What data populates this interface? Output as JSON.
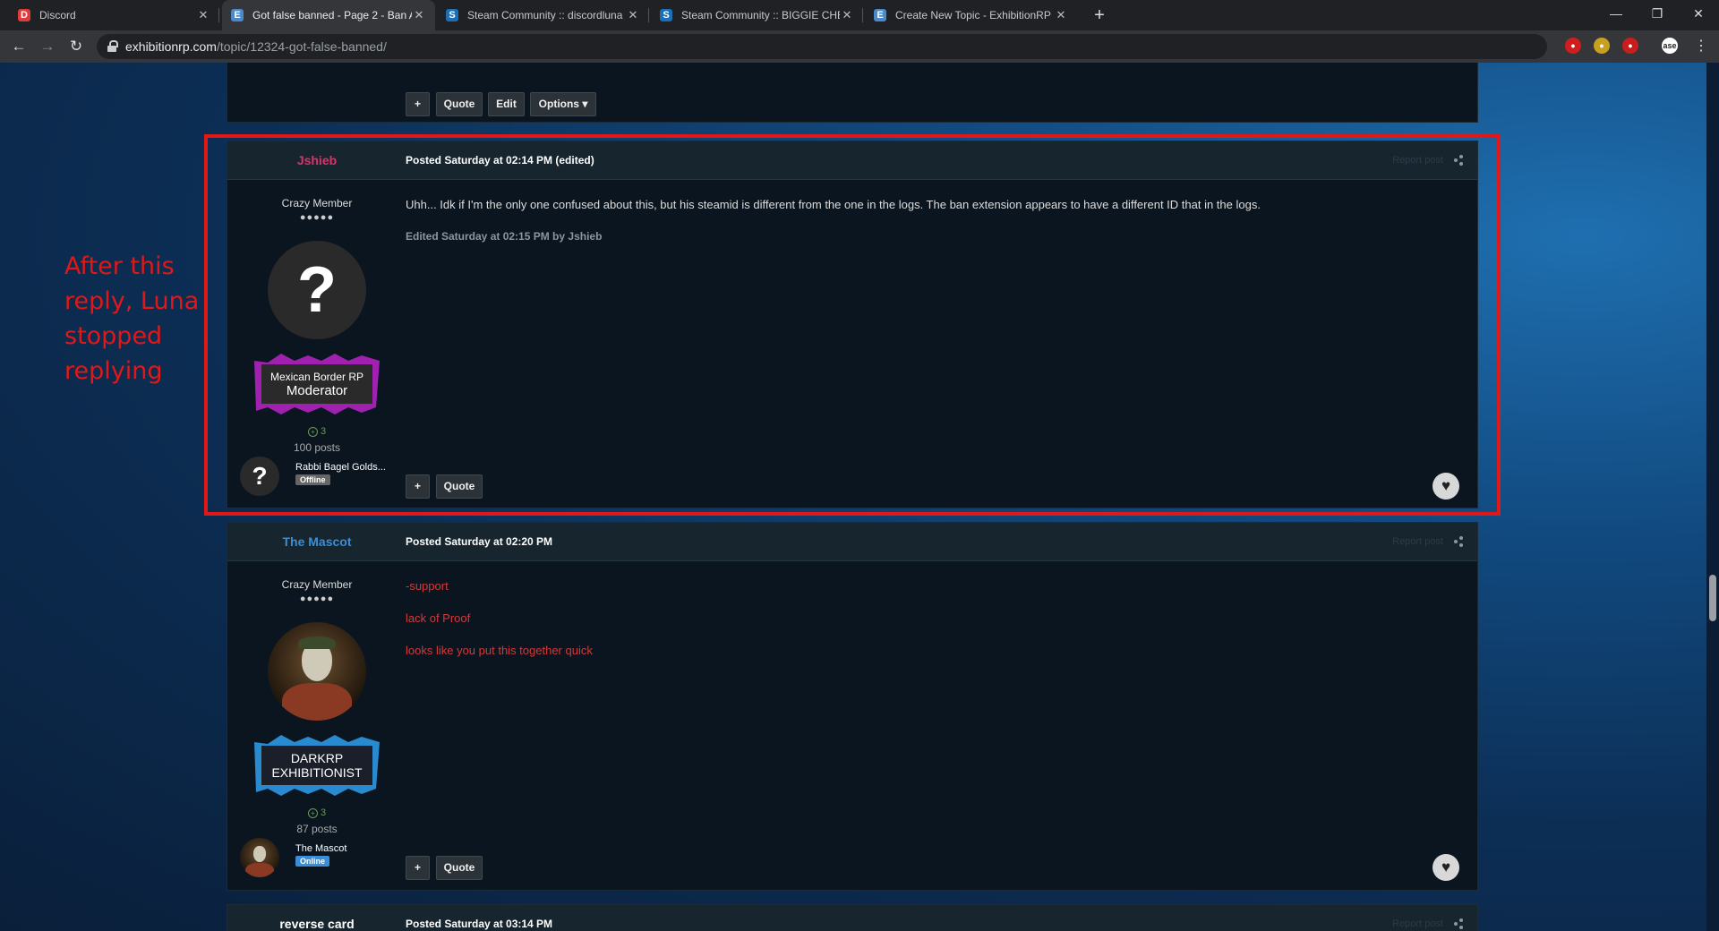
{
  "browser": {
    "tabs": [
      {
        "title": "Discord",
        "favicon": "discord-icon",
        "color": "#e03a3a"
      },
      {
        "title": "Got false banned - Page 2 - Ban A",
        "favicon": "exhibition-icon",
        "color": "#4a8ac8",
        "active": true
      },
      {
        "title": "Steam Community :: discordluna",
        "favicon": "steam-icon",
        "color": "#1b6fb8"
      },
      {
        "title": "Steam Community :: BIGGIE CHEE",
        "favicon": "steam-icon",
        "color": "#1b6fb8"
      },
      {
        "title": "Create New Topic - ExhibitionRP",
        "favicon": "exhibition-icon",
        "color": "#4a8ac8"
      }
    ],
    "url_domain": "exhibitionrp.com",
    "url_path": "/topic/12324-got-false-banned/",
    "profile_initials": "ase"
  },
  "top_post": {
    "buttons": {
      "plus": "+",
      "quote": "Quote",
      "edit": "Edit",
      "options": "Options ▾"
    }
  },
  "annotation": {
    "text": "After this reply, Luna stopped replying"
  },
  "posts": [
    {
      "author": "Jshieb",
      "author_color": "#e0306a",
      "posted": "Posted Saturday at 02:14 PM (edited)",
      "report": "Report post",
      "rank": "Crazy Member",
      "pips": "●●●●●",
      "badge_line1": "Mexican Border RP",
      "badge_line2": "Moderator",
      "badge_color": "#a020b0",
      "rep": "3",
      "post_count": "100 posts",
      "mini_name": "Rabbi Bagel Golds...",
      "status": "Offline",
      "body": "Uhh... Idk if I'm the only one confused about this, but his steamid is different from the one in the logs. The ban extension appears to have a different ID that in the logs.",
      "edited_note": "Edited Saturday at 02:15 PM by Jshieb",
      "buttons": {
        "plus": "+",
        "quote": "Quote"
      }
    },
    {
      "author": "The Mascot",
      "author_color": "#3a8ed8",
      "posted": "Posted Saturday at 02:20 PM",
      "report": "Report post",
      "rank": "Crazy Member",
      "pips": "●●●●●",
      "badge_line1": "DARKRP",
      "badge_line2": "EXHIBITIONIST",
      "badge_color": "#2a8ad0",
      "rep": "3",
      "post_count": "87 posts",
      "mini_name": "The Mascot",
      "status": "Online",
      "body_lines": [
        "-support",
        "lack of Proof",
        "looks like you put this together quick"
      ],
      "buttons": {
        "plus": "+",
        "quote": "Quote"
      }
    },
    {
      "author": "reverse card",
      "author_color": "#ffffff",
      "posted": "Posted Saturday at 03:14 PM",
      "report": "Report post"
    }
  ]
}
